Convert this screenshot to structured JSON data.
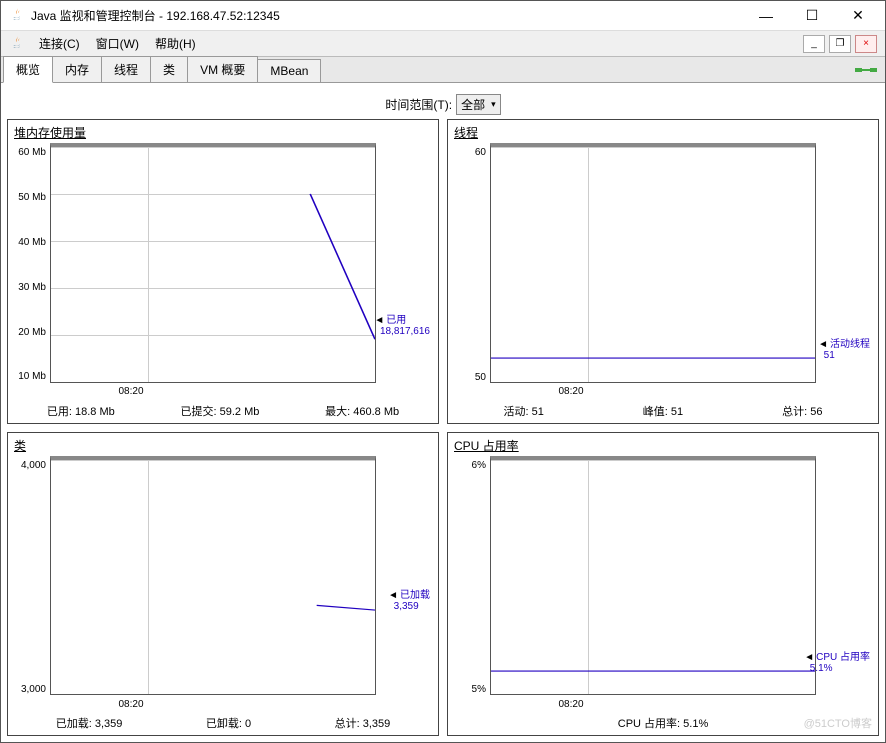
{
  "window": {
    "title": "Java 监视和管理控制台 - 192.168.47.52:12345"
  },
  "menu": {
    "connection": "连接(C)",
    "window": "窗口(W)",
    "help": "帮助(H)"
  },
  "tabs": {
    "overview": "概览",
    "memory": "内存",
    "threads": "线程",
    "classes": "类",
    "vm_summary": "VM 概要",
    "mbeans": "MBean"
  },
  "timerange": {
    "label": "时间范围(T):",
    "value": "全部"
  },
  "watermark": "@51CTO博客",
  "chart_data": [
    {
      "type": "line",
      "title": "堆内存使用量",
      "yticks": [
        "60 Mb",
        "50 Mb",
        "40 Mb",
        "30 Mb",
        "20 Mb",
        "10 Mb"
      ],
      "ylim": [
        10,
        60
      ],
      "xticks": [
        "08:20"
      ],
      "series_name": "已用",
      "series_value": "18,817,616",
      "points": [
        [
          80,
          50
        ],
        [
          100,
          18
        ]
      ],
      "stats": [
        {
          "label": "已用:",
          "value": "18.8  Mb"
        },
        {
          "label": "已提交:",
          "value": "59.2  Mb"
        },
        {
          "label": "最大:",
          "value": "460.8  Mb"
        }
      ]
    },
    {
      "type": "line",
      "title": "线程",
      "yticks": [
        "60",
        "50"
      ],
      "ylim": [
        50,
        60
      ],
      "xticks": [
        "08:20"
      ],
      "series_name": "活动线程",
      "series_value": "51",
      "points": [
        [
          0,
          51
        ],
        [
          100,
          51
        ]
      ],
      "stats": [
        {
          "label": "活动:",
          "value": "51"
        },
        {
          "label": "峰值:",
          "value": "51"
        },
        {
          "label": "总计:",
          "value": "56"
        }
      ]
    },
    {
      "type": "line",
      "title": "类",
      "yticks": [
        "4,000",
        "3,000"
      ],
      "ylim": [
        3000,
        4000
      ],
      "xticks": [
        "08:20"
      ],
      "series_name": "已加载",
      "series_value": "3,359",
      "points": [
        [
          80,
          3380
        ],
        [
          100,
          3359
        ]
      ],
      "stats": [
        {
          "label": "已加载:",
          "value": "3,359"
        },
        {
          "label": "已卸载:",
          "value": "0"
        },
        {
          "label": "总计:",
          "value": "3,359"
        }
      ]
    },
    {
      "type": "line",
      "title": "CPU 占用率",
      "yticks": [
        "6%",
        "5%"
      ],
      "ylim": [
        5,
        6
      ],
      "xticks": [
        "08:20"
      ],
      "series_name": "CPU 占用率",
      "series_value": "5.1%",
      "points": [
        [
          0,
          5.1
        ],
        [
          100,
          5.1
        ]
      ],
      "stats": [
        {
          "label": "CPU 占用率:",
          "value": "5.1%"
        }
      ]
    }
  ]
}
